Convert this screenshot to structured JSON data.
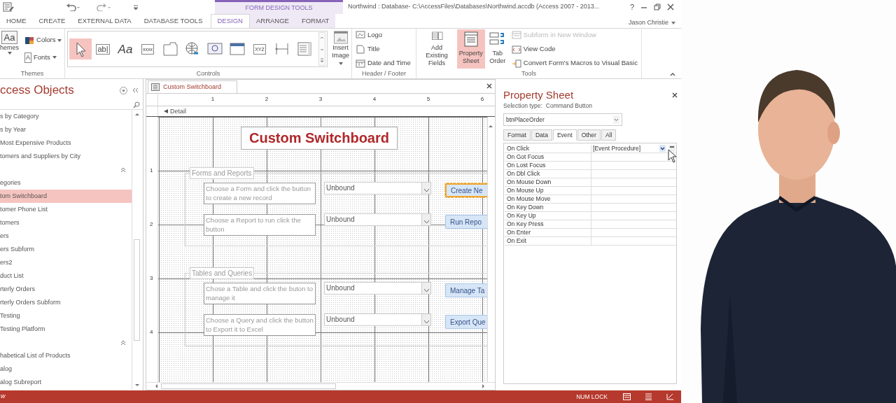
{
  "window": {
    "title": "Northwind : Database- C:\\AccessFiles\\Databases\\Northwind.accdb (Access 2007 - 2013...",
    "help": "?"
  },
  "contextual_group": {
    "label": "FORM DESIGN TOOLS"
  },
  "account": {
    "name": "Jason Christie"
  },
  "tabs": [
    {
      "label": "HOME",
      "selected": false,
      "contextual": false
    },
    {
      "label": "CREATE",
      "selected": false,
      "contextual": false
    },
    {
      "label": "EXTERNAL DATA",
      "selected": false,
      "contextual": false
    },
    {
      "label": "DATABASE TOOLS",
      "selected": false,
      "contextual": false
    },
    {
      "label": "DESIGN",
      "selected": true,
      "contextual": true
    },
    {
      "label": "ARRANGE",
      "selected": false,
      "contextual": true
    },
    {
      "label": "FORMAT",
      "selected": false,
      "contextual": true
    }
  ],
  "ribbon": {
    "themes": {
      "label": "Themes",
      "button": {
        "label": "hemes",
        "glyph": "Aa"
      },
      "small": [
        {
          "kind": "colors",
          "label": "Colors"
        },
        {
          "kind": "fonts",
          "label": "Fonts",
          "glyph": "A"
        }
      ]
    },
    "controls": {
      "label": "Controls",
      "gallery": [
        {
          "kind": "pointer",
          "selected": true
        },
        {
          "kind": "textbox",
          "glyph": "ab|",
          "selected": false
        },
        {
          "kind": "label",
          "glyph": "Aa",
          "selected": false
        },
        {
          "kind": "button",
          "glyph": "xxxx",
          "selected": false
        },
        {
          "kind": "tab",
          "selected": false
        },
        {
          "kind": "hyperlink",
          "selected": false
        },
        {
          "kind": "browser",
          "selected": false
        },
        {
          "kind": "navigation",
          "selected": false
        },
        {
          "kind": "group",
          "glyph": "XYZ",
          "selected": false
        },
        {
          "kind": "pagebreak",
          "selected": false
        },
        {
          "kind": "list",
          "selected": false
        }
      ],
      "insert_image": {
        "label": "Insert",
        "label_2": "Image"
      }
    },
    "header_footer": {
      "label": "Header / Footer",
      "buttons": [
        {
          "kind": "logo",
          "label": "Logo"
        },
        {
          "kind": "title",
          "label": "Title"
        },
        {
          "kind": "datetime",
          "label": "Date and Time"
        }
      ]
    },
    "tools": {
      "label": "Tools",
      "large": [
        {
          "kind": "fields",
          "label": "Add Existing",
          "label_2": "Fields",
          "selected": false
        },
        {
          "kind": "sheet",
          "label": "Property",
          "label_2": "Sheet",
          "selected": true
        },
        {
          "kind": "taborder",
          "label": "Tab",
          "label_2": "Order",
          "selected": false
        }
      ],
      "small": [
        {
          "kind": "subform",
          "label": "Subform in New Window",
          "disabled": true
        },
        {
          "kind": "code",
          "label": "View Code",
          "disabled": false
        },
        {
          "kind": "convert",
          "label": "Convert Form's Macros to Visual Basic",
          "disabled": false
        }
      ]
    }
  },
  "nav": {
    "title": "ccess Objects",
    "items": [
      {
        "kind": "item",
        "label": "s by Category",
        "selected": false
      },
      {
        "kind": "item",
        "label": "s by Year",
        "selected": false
      },
      {
        "kind": "item",
        "label": "Most Expensive Products",
        "selected": false
      },
      {
        "kind": "item",
        "label": "tomers and Suppliers by City",
        "selected": false
      },
      {
        "kind": "header",
        "expanded": true
      },
      {
        "kind": "item",
        "label": "egories",
        "selected": false
      },
      {
        "kind": "item",
        "label": "tom Switchboard",
        "selected": true
      },
      {
        "kind": "item",
        "label": "tomer Phone List",
        "selected": false
      },
      {
        "kind": "item",
        "label": "tomers",
        "selected": false
      },
      {
        "kind": "item",
        "label": "ers",
        "selected": false
      },
      {
        "kind": "item",
        "label": "ers Subform",
        "selected": false
      },
      {
        "kind": "item",
        "label": "ers2",
        "selected": false
      },
      {
        "kind": "item",
        "label": "duct List",
        "selected": false
      },
      {
        "kind": "item",
        "label": "rterly Orders",
        "selected": false
      },
      {
        "kind": "item",
        "label": "rterly Orders Subform",
        "selected": false
      },
      {
        "kind": "item",
        "label": "Testing",
        "selected": false
      },
      {
        "kind": "item",
        "label": "Testing Platform",
        "selected": false
      },
      {
        "kind": "header",
        "expanded": true
      },
      {
        "kind": "item",
        "label": "habetical List of Products",
        "selected": false
      },
      {
        "kind": "item",
        "label": "alog",
        "selected": false
      },
      {
        "kind": "item",
        "label": "alog Subreport",
        "selected": false
      }
    ]
  },
  "document": {
    "tab": "Custom Switchboard",
    "ruler": [
      "1",
      "2",
      "3",
      "4",
      "5",
      "6"
    ],
    "vertical_ruler": [
      "1",
      "2",
      "3",
      "4"
    ],
    "section": "Detail",
    "form_title": "Custom Switchboard",
    "groups": [
      {
        "label": "Forms and Reports",
        "rows": [
          {
            "prompt": "Choose a Form and click the button to create a new record",
            "combo": "Unbound",
            "button": "Create Ne",
            "selected": true
          },
          {
            "prompt": "Choose a Report to run click the button",
            "combo": "Unbound",
            "button": "Run Repo",
            "selected": false
          }
        ]
      },
      {
        "label": "Tables and Queries",
        "rows": [
          {
            "prompt": "Chose a Table and click the buton to manage it",
            "combo": "Unbound",
            "button": "Manage Ta",
            "selected": false
          },
          {
            "prompt": "Choose a Query and click the button to Export it to Excel",
            "combo": "Unbound",
            "button": "Export Que",
            "selected": false
          }
        ]
      }
    ]
  },
  "property_sheet": {
    "title": "Property Sheet",
    "selection_label": "Selection type:",
    "selection_type": "Command Button",
    "object": "btnPlaceOrder",
    "tabs": [
      {
        "label": "Format",
        "selected": false
      },
      {
        "label": "Data",
        "selected": false
      },
      {
        "label": "Event",
        "selected": true
      },
      {
        "label": "Other",
        "selected": false
      },
      {
        "label": "All",
        "selected": false
      }
    ],
    "properties": [
      {
        "name": "On Click",
        "value": "[Event Procedure]"
      },
      {
        "name": "On Got Focus"
      },
      {
        "name": "On Lost Focus"
      },
      {
        "name": "On Dbl Click"
      },
      {
        "name": "On Mouse Down"
      },
      {
        "name": "On Mouse Up"
      },
      {
        "name": "On Mouse Move"
      },
      {
        "name": "On Key Down"
      },
      {
        "name": "On Key Up"
      },
      {
        "name": "On Key Press"
      },
      {
        "name": "On Enter"
      },
      {
        "name": "On Exit"
      }
    ]
  },
  "status_bar": {
    "left": "w",
    "indicators": [
      "NUM LOCK"
    ]
  }
}
